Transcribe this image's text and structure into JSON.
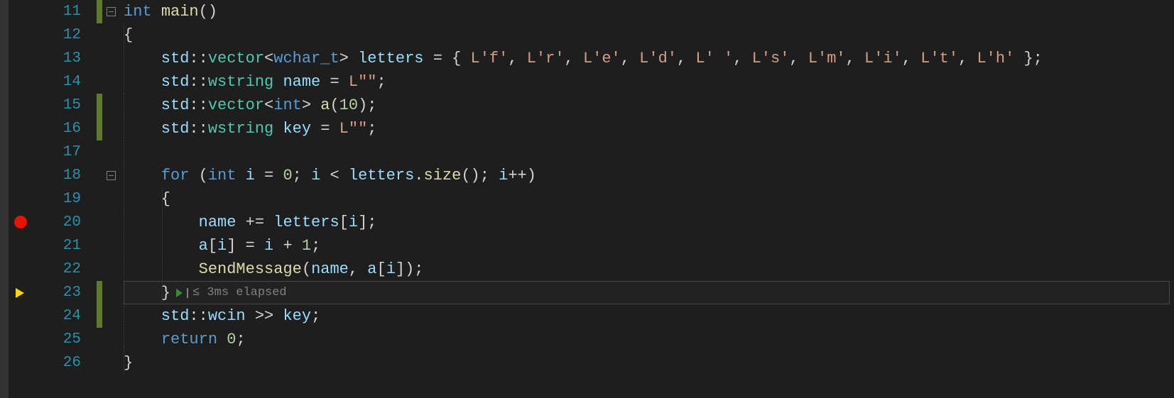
{
  "firstLine": 11,
  "lastLine": 26,
  "breakpointLine": 20,
  "currentLine": 23,
  "changeMarks": [
    {
      "from": 11,
      "to": 11
    },
    {
      "from": 15,
      "to": 16
    },
    {
      "from": 23,
      "to": 24
    }
  ],
  "foldBoxes": [
    11,
    18
  ],
  "perfTip": {
    "line": 23,
    "text": "≤ 3ms elapsed"
  },
  "code": {
    "l11": [
      {
        "t": "int",
        "c": "kw"
      },
      {
        "t": " "
      },
      {
        "t": "main",
        "c": "fn"
      },
      {
        "t": "()"
      }
    ],
    "l12": [
      {
        "t": "{"
      }
    ],
    "l13": [
      {
        "t": "    std",
        "c": "var"
      },
      {
        "t": "::"
      },
      {
        "t": "vector",
        "c": "cls"
      },
      {
        "t": "<"
      },
      {
        "t": "wchar_t",
        "c": "kw"
      },
      {
        "t": "> "
      },
      {
        "t": "letters",
        "c": "var"
      },
      {
        "t": " = { "
      },
      {
        "t": "L'f'",
        "c": "str"
      },
      {
        "t": ", "
      },
      {
        "t": "L'r'",
        "c": "str"
      },
      {
        "t": ", "
      },
      {
        "t": "L'e'",
        "c": "str"
      },
      {
        "t": ", "
      },
      {
        "t": "L'd'",
        "c": "str"
      },
      {
        "t": ", "
      },
      {
        "t": "L' '",
        "c": "str"
      },
      {
        "t": ", "
      },
      {
        "t": "L's'",
        "c": "str"
      },
      {
        "t": ", "
      },
      {
        "t": "L'm'",
        "c": "str"
      },
      {
        "t": ", "
      },
      {
        "t": "L'i'",
        "c": "str"
      },
      {
        "t": ", "
      },
      {
        "t": "L't'",
        "c": "str"
      },
      {
        "t": ", "
      },
      {
        "t": "L'h'",
        "c": "str"
      },
      {
        "t": " };"
      }
    ],
    "l14": [
      {
        "t": "    std",
        "c": "var"
      },
      {
        "t": "::"
      },
      {
        "t": "wstring",
        "c": "cls"
      },
      {
        "t": " "
      },
      {
        "t": "name",
        "c": "var"
      },
      {
        "t": " = "
      },
      {
        "t": "L\"\"",
        "c": "str"
      },
      {
        "t": ";"
      }
    ],
    "l15": [
      {
        "t": "    std",
        "c": "var"
      },
      {
        "t": "::"
      },
      {
        "t": "vector",
        "c": "cls"
      },
      {
        "t": "<"
      },
      {
        "t": "int",
        "c": "kw"
      },
      {
        "t": "> "
      },
      {
        "t": "a",
        "c": "fn"
      },
      {
        "t": "("
      },
      {
        "t": "10",
        "c": "num"
      },
      {
        "t": ");"
      }
    ],
    "l16": [
      {
        "t": "    std",
        "c": "var"
      },
      {
        "t": "::"
      },
      {
        "t": "wstring",
        "c": "cls"
      },
      {
        "t": " "
      },
      {
        "t": "key",
        "c": "var"
      },
      {
        "t": " = "
      },
      {
        "t": "L\"\"",
        "c": "str"
      },
      {
        "t": ";"
      }
    ],
    "l17": [],
    "l18": [
      {
        "t": "    "
      },
      {
        "t": "for",
        "c": "kw"
      },
      {
        "t": " ("
      },
      {
        "t": "int",
        "c": "kw"
      },
      {
        "t": " "
      },
      {
        "t": "i",
        "c": "var"
      },
      {
        "t": " = "
      },
      {
        "t": "0",
        "c": "num"
      },
      {
        "t": "; "
      },
      {
        "t": "i",
        "c": "var"
      },
      {
        "t": " < "
      },
      {
        "t": "letters",
        "c": "var"
      },
      {
        "t": "."
      },
      {
        "t": "size",
        "c": "fn"
      },
      {
        "t": "(); "
      },
      {
        "t": "i",
        "c": "var"
      },
      {
        "t": "++)"
      }
    ],
    "l19": [
      {
        "t": "    {"
      }
    ],
    "l20": [
      {
        "t": "        "
      },
      {
        "t": "name",
        "c": "var"
      },
      {
        "t": " += "
      },
      {
        "t": "letters",
        "c": "var"
      },
      {
        "t": "["
      },
      {
        "t": "i",
        "c": "var"
      },
      {
        "t": "];"
      }
    ],
    "l21": [
      {
        "t": "        "
      },
      {
        "t": "a",
        "c": "var"
      },
      {
        "t": "["
      },
      {
        "t": "i",
        "c": "var"
      },
      {
        "t": "] = "
      },
      {
        "t": "i",
        "c": "var"
      },
      {
        "t": " + "
      },
      {
        "t": "1",
        "c": "num"
      },
      {
        "t": ";"
      }
    ],
    "l22": [
      {
        "t": "        "
      },
      {
        "t": "SendMessage",
        "c": "fn"
      },
      {
        "t": "("
      },
      {
        "t": "name",
        "c": "var"
      },
      {
        "t": ", "
      },
      {
        "t": "a",
        "c": "var"
      },
      {
        "t": "["
      },
      {
        "t": "i",
        "c": "var"
      },
      {
        "t": "]);"
      }
    ],
    "l23": [
      {
        "t": "    }"
      }
    ],
    "l24": [
      {
        "t": "    std",
        "c": "var"
      },
      {
        "t": "::"
      },
      {
        "t": "wcin",
        "c": "var"
      },
      {
        "t": " >> "
      },
      {
        "t": "key",
        "c": "var"
      },
      {
        "t": ";"
      }
    ],
    "l25": [
      {
        "t": "    "
      },
      {
        "t": "return",
        "c": "kw"
      },
      {
        "t": " "
      },
      {
        "t": "0",
        "c": "num"
      },
      {
        "t": ";"
      }
    ],
    "l26": [
      {
        "t": "}"
      }
    ]
  },
  "indentGuides": {
    "12": [
      0
    ],
    "13": [
      0
    ],
    "14": [
      0
    ],
    "15": [
      0
    ],
    "16": [
      0
    ],
    "17": [
      0
    ],
    "18": [
      0
    ],
    "19": [
      0,
      1
    ],
    "20": [
      0,
      1
    ],
    "21": [
      0,
      1
    ],
    "22": [
      0,
      1
    ],
    "23": [
      0,
      1
    ],
    "24": [
      0
    ],
    "25": [
      0
    ],
    "26": [
      0
    ]
  }
}
